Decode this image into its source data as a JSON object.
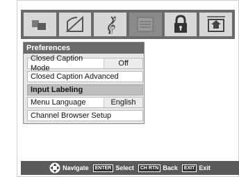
{
  "icon_tabs": [
    {
      "icon": "picture-icon"
    },
    {
      "icon": "setup-icon"
    },
    {
      "icon": "audio-icon"
    },
    {
      "icon": "preferences-icon",
      "active": true
    },
    {
      "icon": "lock-icon"
    },
    {
      "icon": "applications-icon"
    }
  ],
  "menu": {
    "title": "Preferences",
    "items": [
      {
        "label": "Closed Caption Mode",
        "value": "Off"
      },
      {
        "label": "Closed Caption Advanced",
        "value": ""
      },
      {
        "label": "Input Labeling",
        "value": "",
        "selected": true
      },
      {
        "label": "Menu Language",
        "value": "English"
      },
      {
        "label": "Channel Browser Setup",
        "value": ""
      }
    ]
  },
  "footer": {
    "navigate_label": "Navigate",
    "enter_key": "ENTER",
    "select_label": "Select",
    "chrtn_key": "CH RTN",
    "back_label": "Back",
    "exit_key": "EXIT",
    "exit_label": "Exit"
  },
  "colors": {
    "bar": "#6a6a6a",
    "selected": "#bdbdbd",
    "footer": "#5a5a5a"
  }
}
